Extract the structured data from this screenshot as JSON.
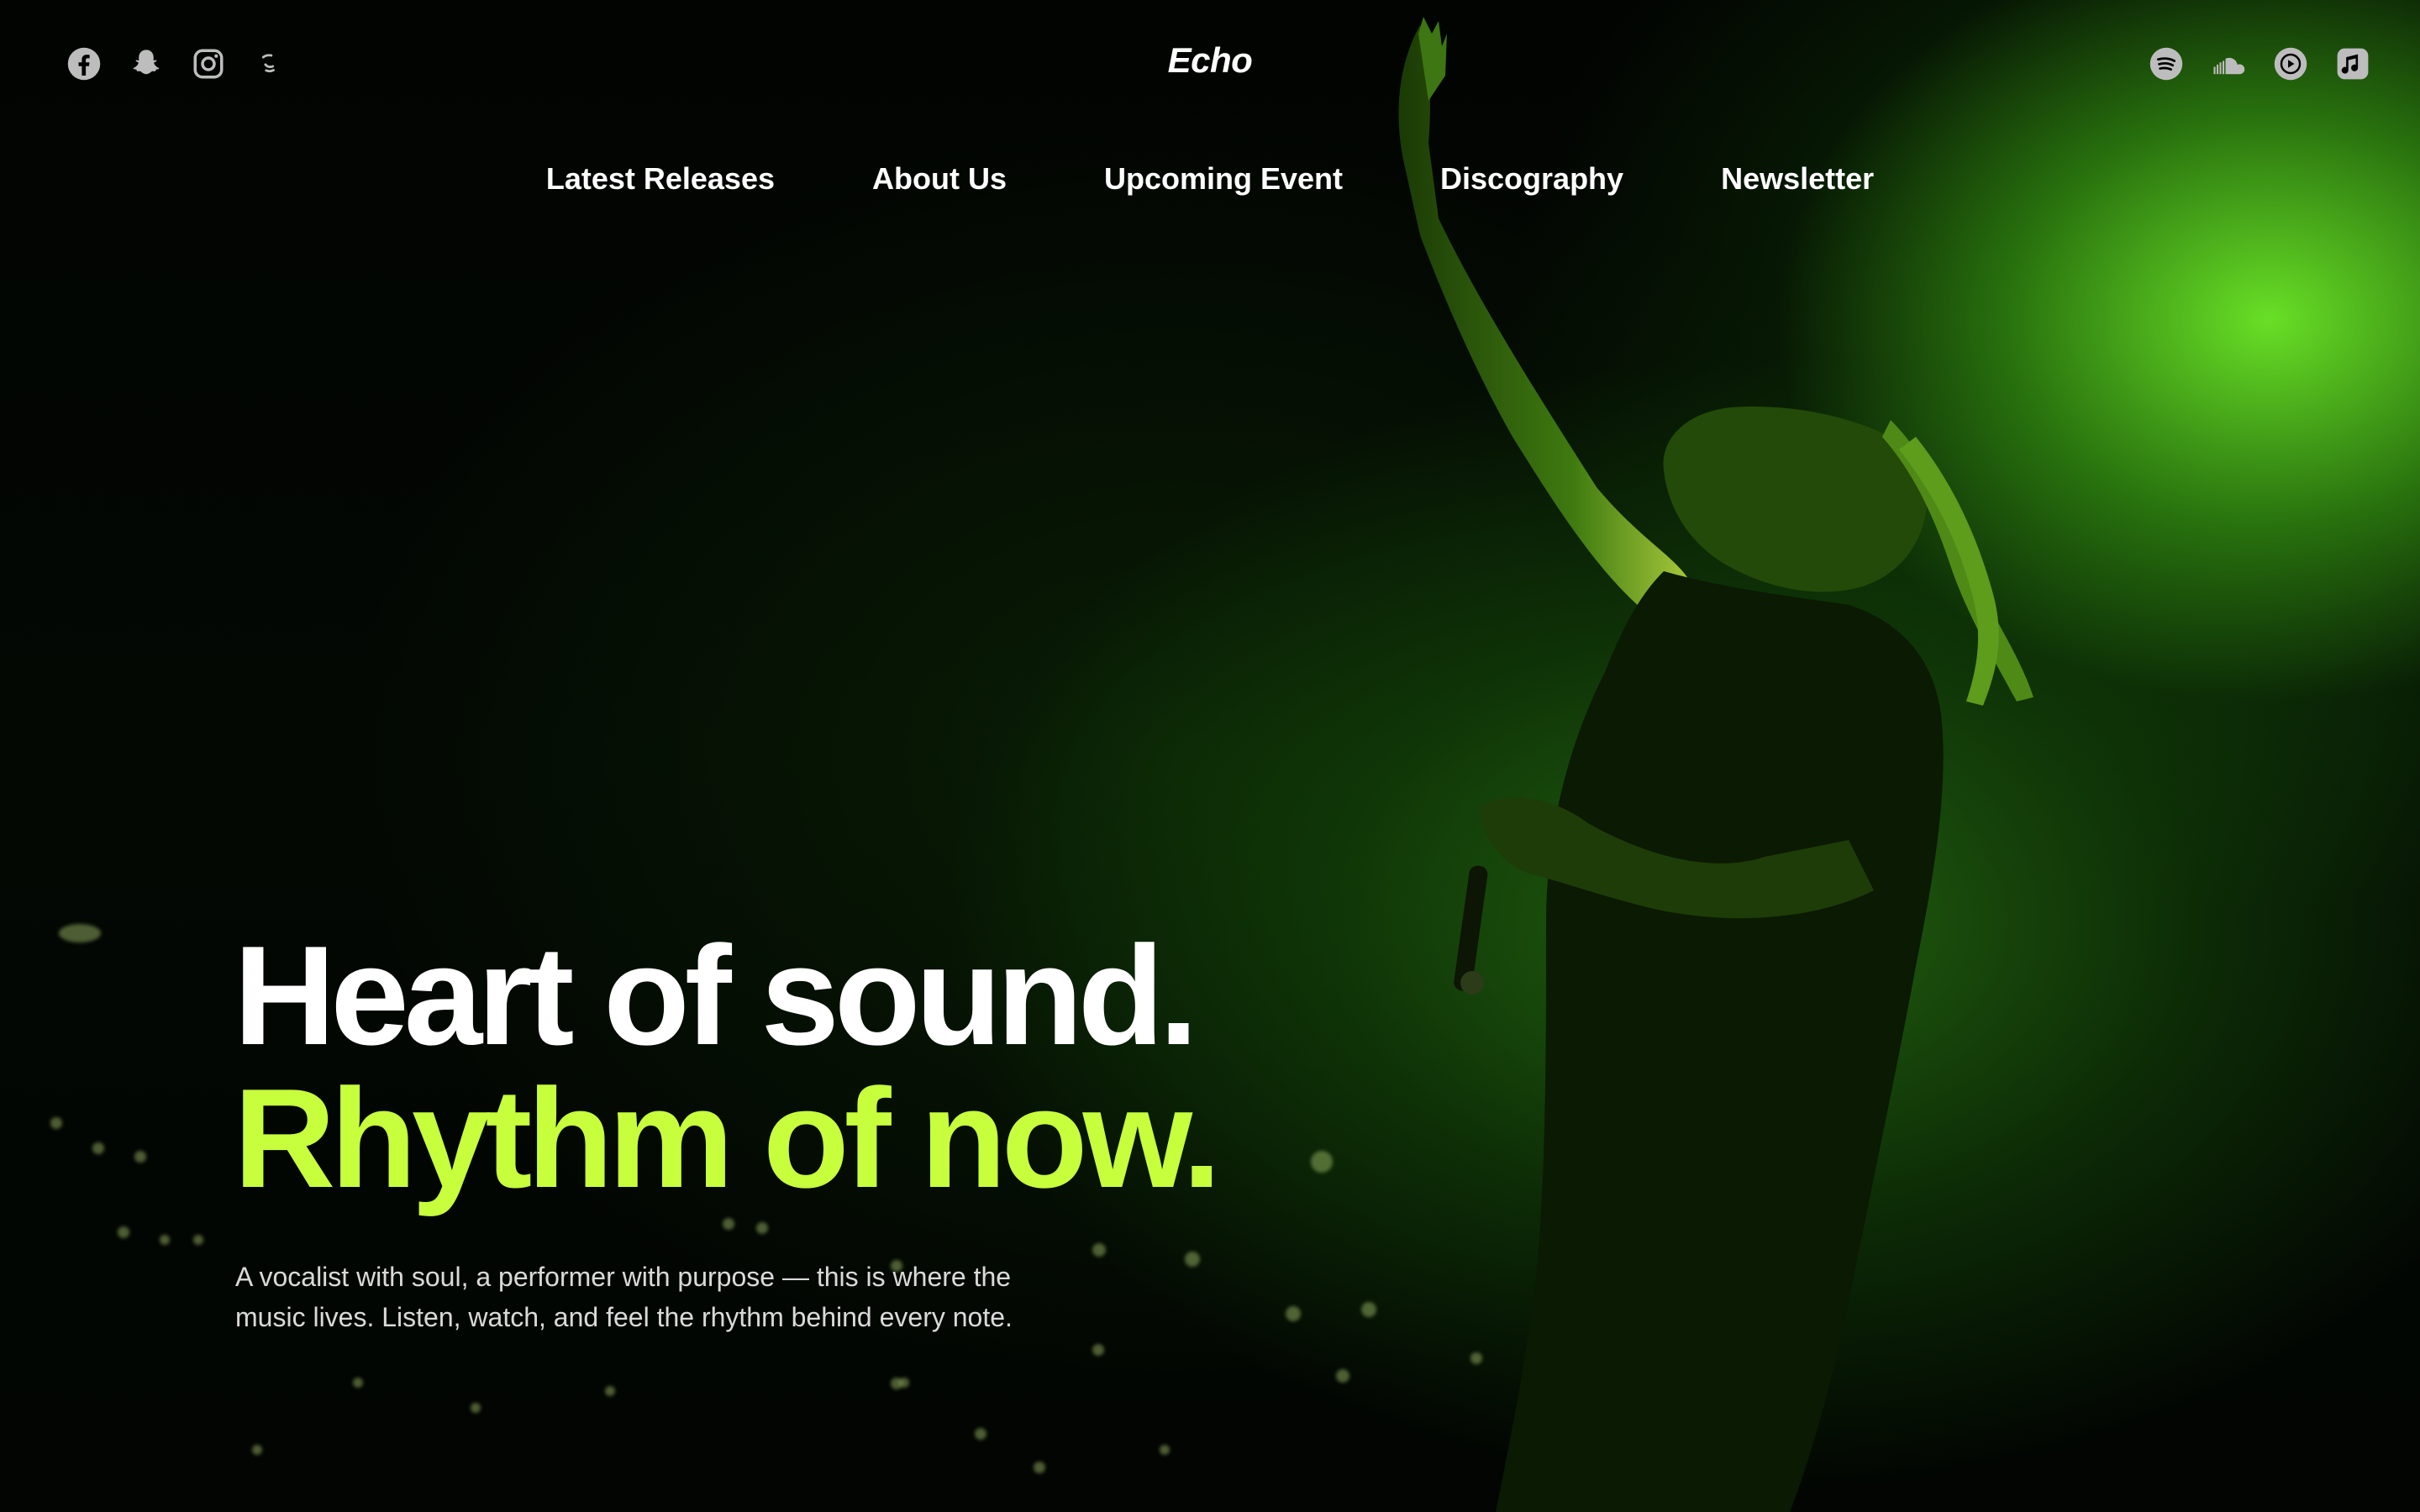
{
  "brand": {
    "logo": "Echo"
  },
  "social_left": [
    {
      "icon": "facebook-icon"
    },
    {
      "icon": "snapchat-icon"
    },
    {
      "icon": "instagram-icon"
    },
    {
      "icon": "threads-icon"
    }
  ],
  "social_right": [
    {
      "icon": "spotify-icon"
    },
    {
      "icon": "soundcloud-icon"
    },
    {
      "icon": "youtube-music-icon"
    },
    {
      "icon": "apple-music-icon"
    }
  ],
  "nav": {
    "items": [
      {
        "label": "Latest Releases"
      },
      {
        "label": "About Us"
      },
      {
        "label": "Upcoming Event"
      },
      {
        "label": "Discography"
      },
      {
        "label": "Newsletter"
      }
    ]
  },
  "hero": {
    "headline_line1": "Heart of sound.",
    "headline_line2": "Rhythm of now.",
    "description": "A vocalist with soul, a performer with purpose — this is where the music lives. Listen, watch, and feel the rhythm behind every note."
  },
  "colors": {
    "accent": "#c7ff3d",
    "background": "#000000",
    "glow": "#6eeb28",
    "icon": "#bdbdbd"
  }
}
